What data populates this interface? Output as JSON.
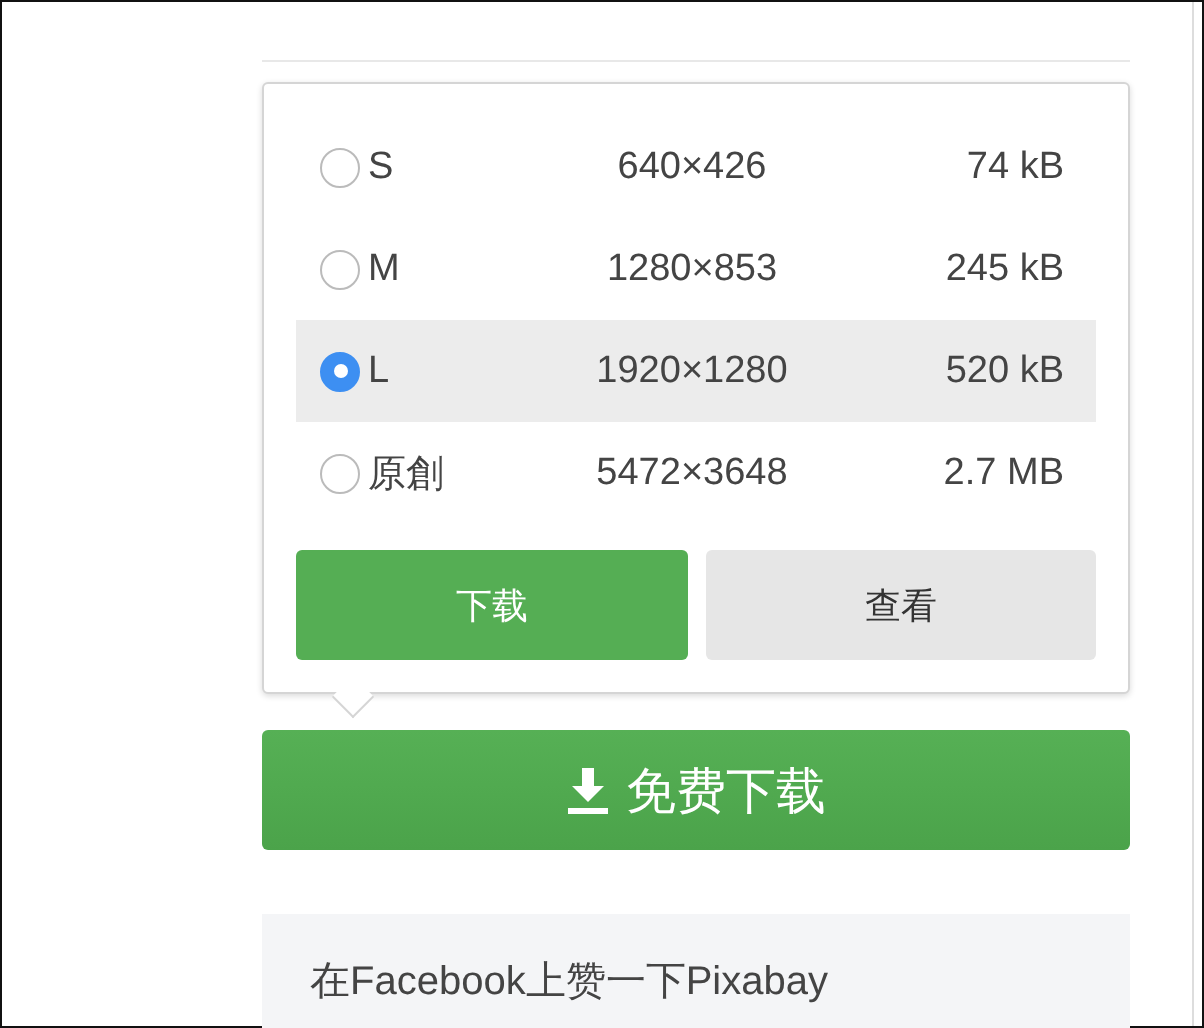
{
  "sizes": [
    {
      "label": "S",
      "dimensions": "640×426",
      "filesize": "74 kB",
      "selected": false
    },
    {
      "label": "M",
      "dimensions": "1280×853",
      "filesize": "245 kB",
      "selected": false
    },
    {
      "label": "L",
      "dimensions": "1920×1280",
      "filesize": "520 kB",
      "selected": true
    },
    {
      "label": "原創",
      "dimensions": "5472×3648",
      "filesize": "2.7 MB",
      "selected": false
    }
  ],
  "popup_buttons": [
    {
      "label": "下载",
      "kind": "primary"
    },
    {
      "label": "查看",
      "kind": "secondary"
    }
  ],
  "main_button": {
    "label": "免费下载"
  },
  "facebook_box": {
    "text": "在Facebook上赞一下Pixabay"
  }
}
